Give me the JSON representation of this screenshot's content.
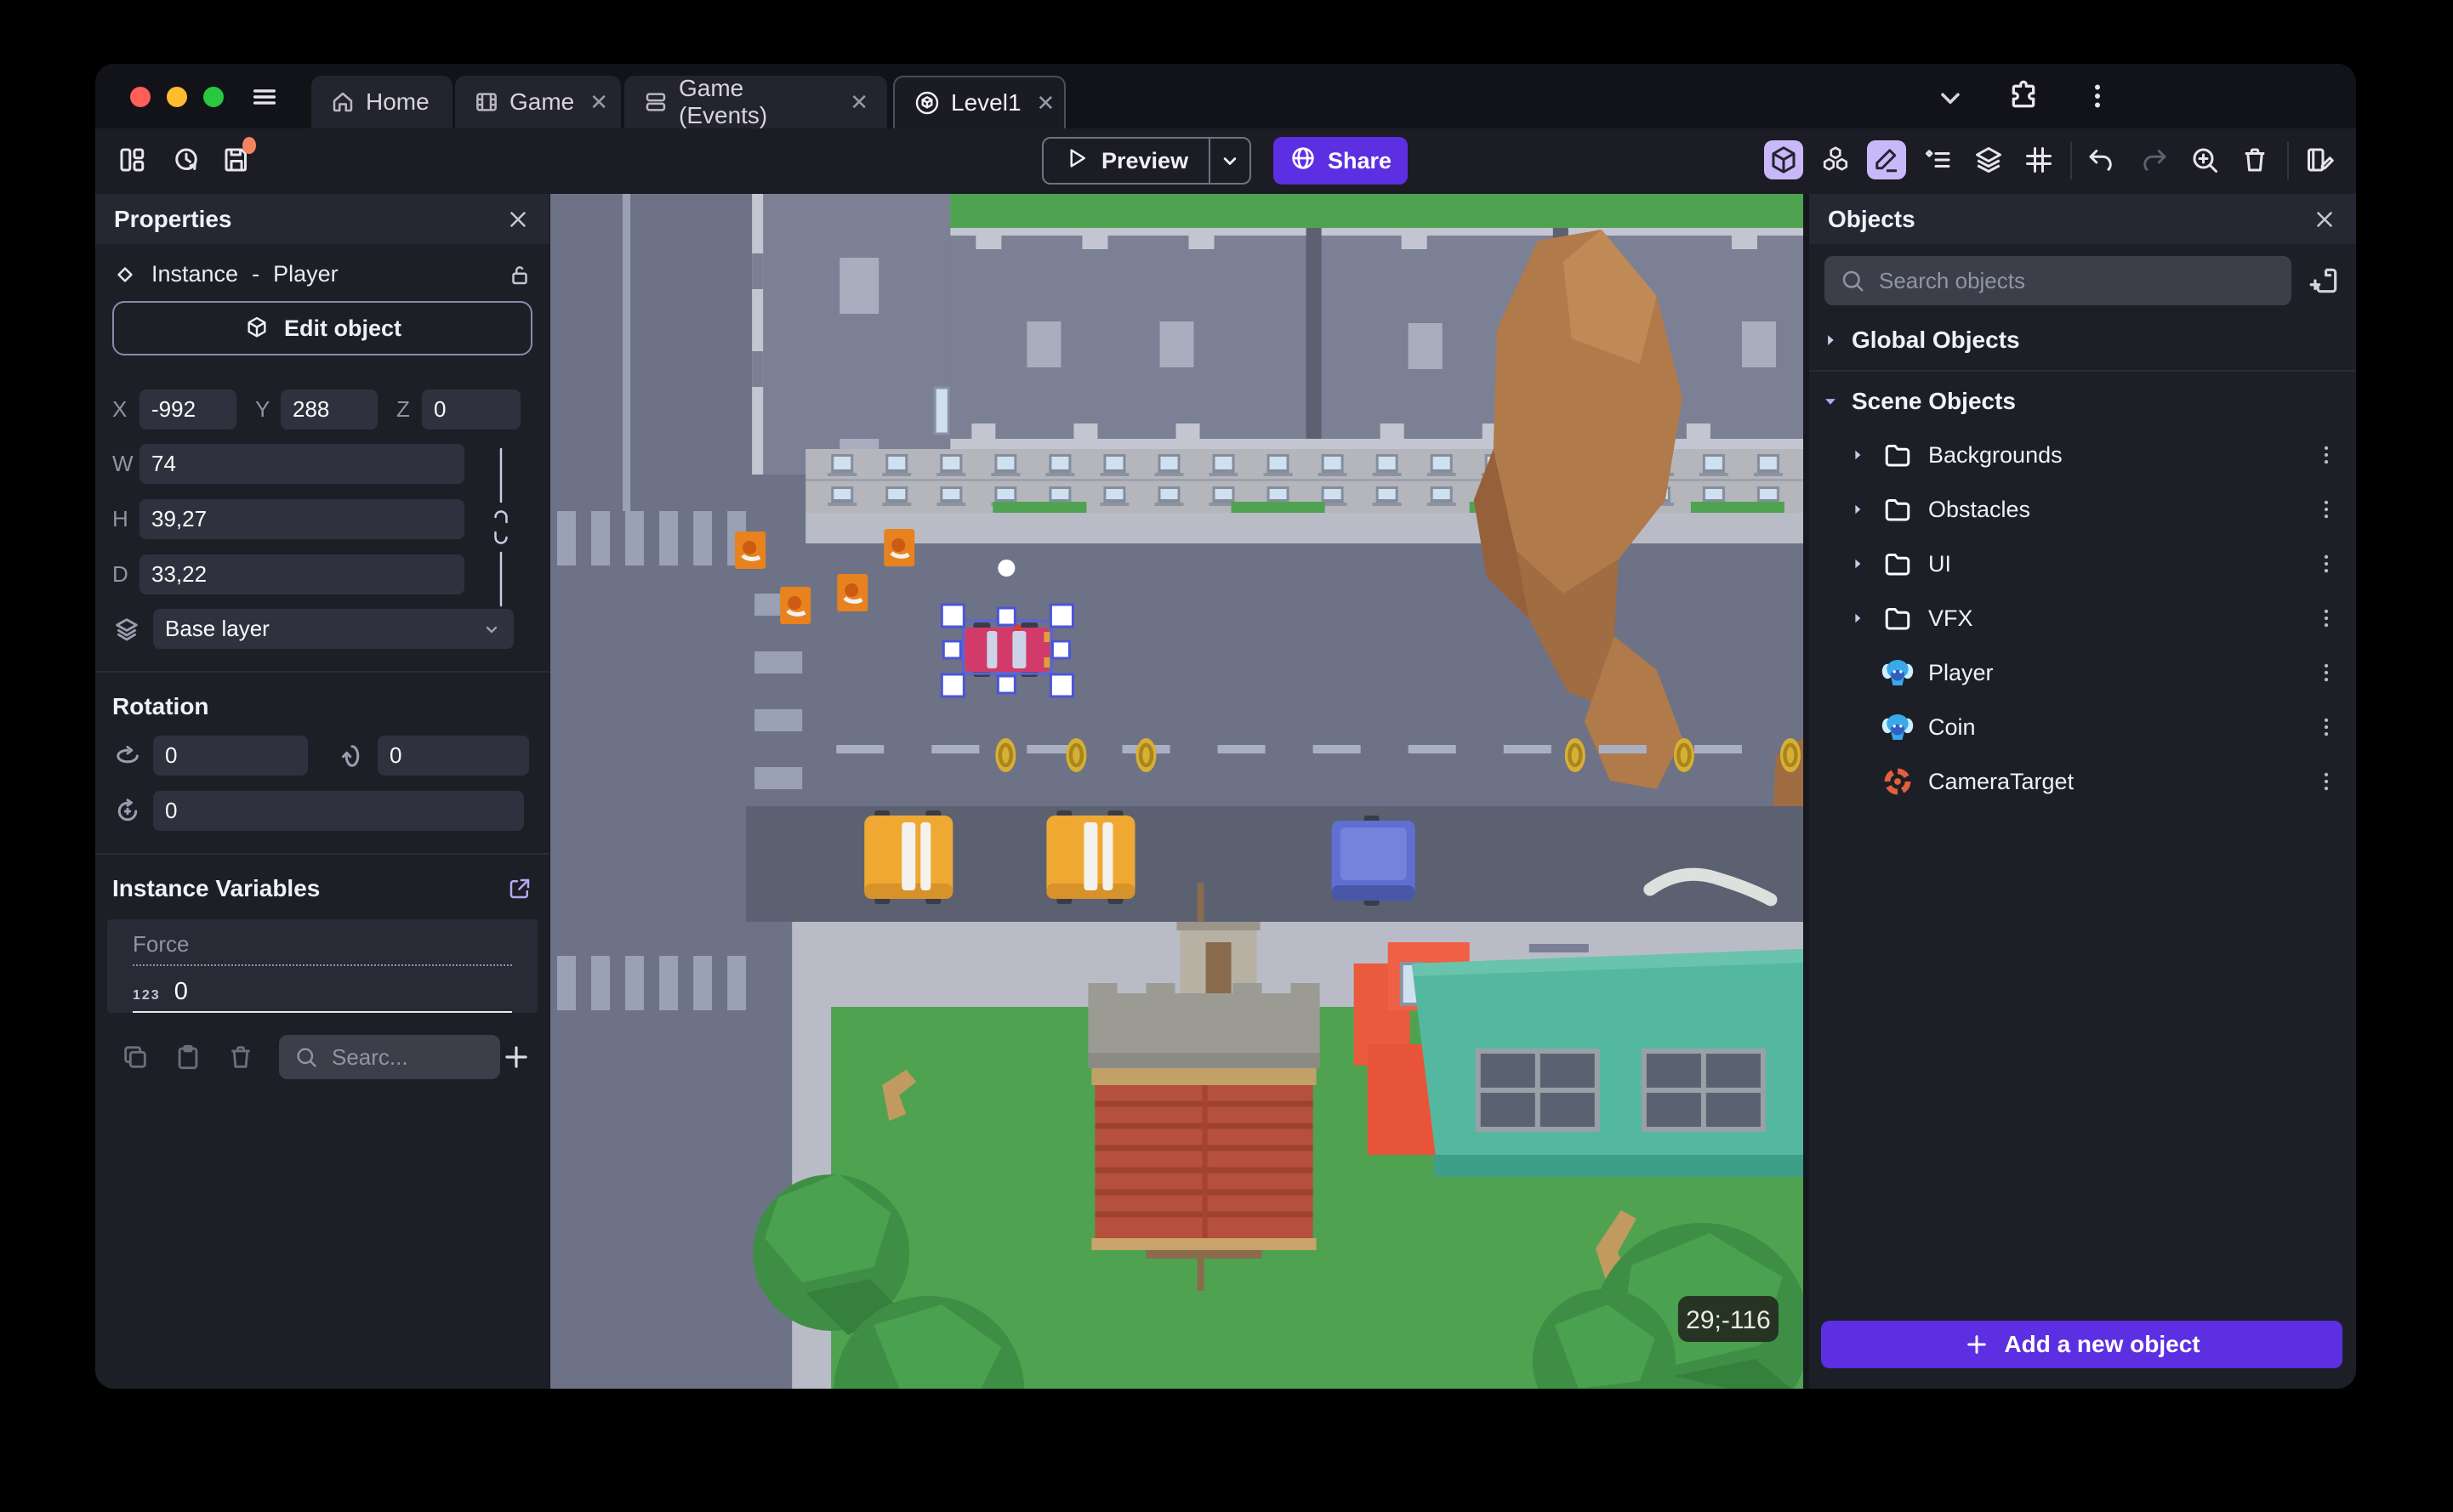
{
  "colors": {
    "accent_purple": "#5c2fe2",
    "active_tool_bg": "#c9b8f9",
    "selection_blue": "#5b63d8",
    "save_badge_orange": "#f4845f",
    "traffic_red": "#ff5f57",
    "traffic_yellow": "#febc2e",
    "traffic_green": "#28c840",
    "canvas_road": "#6d7286",
    "canvas_grass": "#4fa350"
  },
  "tab_bar": {
    "tabs": [
      {
        "label": "Home",
        "icon": "home-icon",
        "closable": false,
        "active": false
      },
      {
        "label": "Game",
        "icon": "film-icon",
        "closable": true,
        "active": false
      },
      {
        "label": "Game (Events)",
        "icon": "events-icon",
        "closable": true,
        "active": false
      },
      {
        "label": "Level1",
        "icon": "scene-icon",
        "closable": true,
        "active": true
      }
    ]
  },
  "toolbar": {
    "preview_label": "Preview",
    "share_label": "Share"
  },
  "properties_panel": {
    "title": "Properties",
    "instance_label": "Instance",
    "separator": "-",
    "object_name": "Player",
    "edit_object_label": "Edit object",
    "position": {
      "x_label": "X",
      "x_value": "-992",
      "y_label": "Y",
      "y_value": "288",
      "z_label": "Z",
      "z_value": "0"
    },
    "size": {
      "w_label": "W",
      "w_value": "74",
      "h_label": "H",
      "h_value": "39,27",
      "d_label": "D",
      "d_value": "33,22"
    },
    "layer_value": "Base layer",
    "rotation": {
      "title": "Rotation",
      "x_value": "0",
      "y_value": "0",
      "z_value": "0"
    },
    "instance_variables": {
      "title": "Instance Variables",
      "rows": [
        {
          "name": "Force",
          "type_badge": "123",
          "value": "0"
        }
      ],
      "search_placeholder": "Searc..."
    }
  },
  "objects_panel": {
    "title": "Objects",
    "search_placeholder": "Search objects",
    "sections": [
      {
        "label": "Global Objects",
        "expanded": false
      },
      {
        "label": "Scene Objects",
        "expanded": true
      }
    ],
    "items": [
      {
        "label": "Backgrounds",
        "kind": "folder"
      },
      {
        "label": "Obstacles",
        "kind": "folder"
      },
      {
        "label": "UI",
        "kind": "folder"
      },
      {
        "label": "VFX",
        "kind": "folder"
      },
      {
        "label": "Player",
        "kind": "3d-model"
      },
      {
        "label": "Coin",
        "kind": "3d-model"
      },
      {
        "label": "CameraTarget",
        "kind": "camera-target"
      }
    ],
    "add_button_label": "Add a new object"
  },
  "canvas": {
    "cursor_coordinates": "29;-116"
  }
}
